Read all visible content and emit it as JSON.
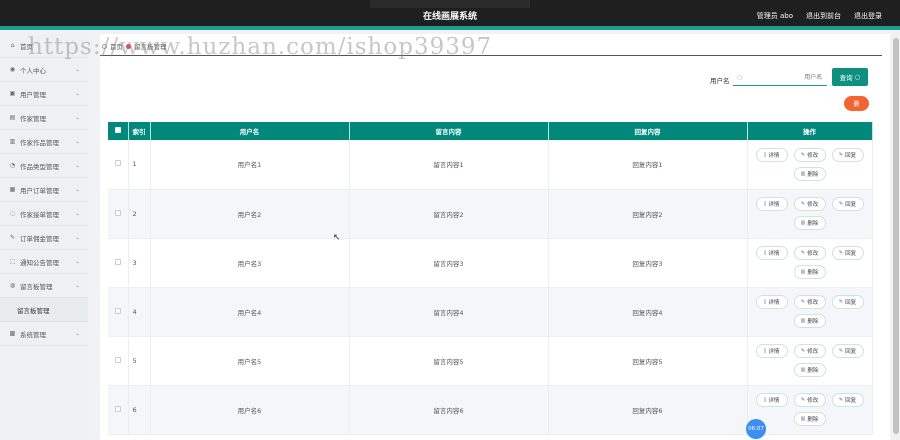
{
  "topbar": {
    "title": "在线画展系统",
    "admin_label": "管理员 abo",
    "back_label": "退出到前台",
    "logout_label": "退出登录"
  },
  "sidebar": {
    "items": [
      {
        "label": "首页",
        "icon": "home-icon",
        "glyph": "⌂",
        "chevron": false
      },
      {
        "label": "个人中心",
        "icon": "user-icon",
        "glyph": "◉",
        "chevron": true
      },
      {
        "label": "用户管理",
        "icon": "users-icon",
        "glyph": "▣",
        "chevron": true
      },
      {
        "label": "作家管理",
        "icon": "writer-icon",
        "glyph": "▤",
        "chevron": true
      },
      {
        "label": "作家作品管理",
        "icon": "works-icon",
        "glyph": "▥",
        "chevron": true
      },
      {
        "label": "作品类型管理",
        "icon": "type-icon",
        "glyph": "◔",
        "chevron": true
      },
      {
        "label": "用户订单管理",
        "icon": "order-icon",
        "glyph": "▦",
        "chevron": true
      },
      {
        "label": "作家接单管理",
        "icon": "accept-icon",
        "glyph": "◌",
        "chevron": true
      },
      {
        "label": "订单佣金管理",
        "icon": "commission-icon",
        "glyph": "✎",
        "chevron": true
      },
      {
        "label": "通知公告管理",
        "icon": "notice-icon",
        "glyph": "⬚",
        "chevron": true
      },
      {
        "label": "留言板管理",
        "icon": "message-icon",
        "glyph": "◍",
        "chevron": true
      }
    ],
    "sub_item": "留言板管理",
    "last_item": {
      "label": "系统管理",
      "icon": "system-icon",
      "glyph": "▩"
    }
  },
  "breadcrumb": {
    "home": "首页",
    "current": "留言板管理"
  },
  "watermark": "https://www.huzhan.com/ishop39397",
  "search": {
    "label": "用户名",
    "placeholder": "用户名",
    "button_label": "查询"
  },
  "delete_all_label": "删",
  "table": {
    "headers": [
      "索引",
      "用户名",
      "留言内容",
      "回复内容",
      "操作"
    ],
    "op_labels": {
      "detail": "详情",
      "edit": "修改",
      "reply": "回复",
      "delete": "删除"
    },
    "rows": [
      {
        "index": "1",
        "username": "用户名1",
        "message": "留言内容1",
        "reply": "回复内容1"
      },
      {
        "index": "2",
        "username": "用户名2",
        "message": "留言内容2",
        "reply": "回复内容2"
      },
      {
        "index": "3",
        "username": "用户名3",
        "message": "留言内容3",
        "reply": "回复内容3"
      },
      {
        "index": "4",
        "username": "用户名4",
        "message": "留言内容4",
        "reply": "回复内容4"
      },
      {
        "index": "5",
        "username": "用户名5",
        "message": "留言内容5",
        "reply": "回复内容5"
      },
      {
        "index": "6",
        "username": "用户名6",
        "message": "留言内容6",
        "reply": "回复内容6"
      }
    ]
  },
  "clock": "06:07",
  "colors": {
    "primary": "#00897b",
    "danger": "#f26432",
    "topbar": "#1f1f1f"
  }
}
